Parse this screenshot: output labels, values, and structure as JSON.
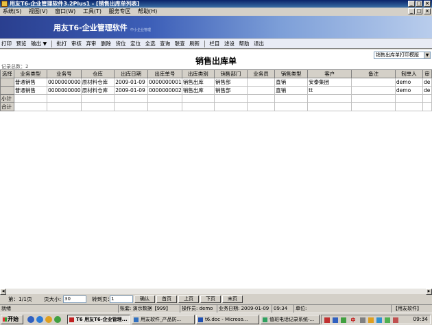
{
  "window": {
    "title": "用友T6-企业管理软件3.2Plus1  - [销售出库单列表]",
    "btn_min": "_",
    "btn_max": "□",
    "btn_close": "×",
    "inner_min": "_",
    "inner_max": "□",
    "inner_close": "×"
  },
  "menu": [
    "系统(S)",
    "视图(V)",
    "窗口(W)",
    "工具(T)",
    "服务专区",
    "帮助(H)"
  ],
  "banner": {
    "logo": "用友T6-企业管理软件",
    "sub": "中小企业管理"
  },
  "toolbar": [
    "打印",
    "预览",
    "输出 ▼",
    "|",
    "批打",
    "审核",
    "弃审",
    "删除",
    "货位",
    "定位",
    "全选",
    "查询",
    "联查",
    "刷新",
    "|",
    "栏目",
    "滤设",
    "帮助",
    "退出"
  ],
  "list": {
    "title": "销售出库单",
    "record_count": "记录总数：2",
    "template": "销售出库单打印模版",
    "template_arrow": "▼",
    "columns": [
      "选择",
      "业务类型",
      "业务号",
      "仓库",
      "出库日期",
      "出库单号",
      "出库类别",
      "销售部门",
      "业务员",
      "销售类型",
      "客户",
      "备注",
      "制单人",
      "审"
    ],
    "rows": [
      [
        "",
        "普通销售",
        "0000000000",
        "原材料仓库",
        "2009-01-09",
        "0000000001",
        "销售出库",
        "销售部",
        "",
        "直销",
        "安泰集团",
        "",
        "demo",
        "de"
      ],
      [
        "",
        "普通销售",
        "0000000000",
        "原材料仓库",
        "2009-01-09",
        "0000000002",
        "销售出库",
        "销售部",
        "",
        "直销",
        "tt",
        "",
        "demo",
        "de"
      ]
    ],
    "subtotal_label": "小计",
    "total_label": "合计"
  },
  "scrollbar": {
    "left": "◀",
    "right": "▶"
  },
  "pager": {
    "page_info": "第：1/1页",
    "page_size_label": "页大小:",
    "page_size": "30",
    "goto_label": "转到页：",
    "goto_value": "1",
    "confirm": "确认",
    "first": "首页",
    "prev": "上页",
    "next": "下页",
    "last": "末页"
  },
  "status": {
    "ready": "就绪",
    "account": "账套: 演示数据【999】",
    "operator": "操作员: demo",
    "biz_date": "业务日期: 2009-01-09",
    "time": "09:34",
    "unit": "单位:",
    "brand": "【用友软件】"
  },
  "taskbar": {
    "start": "开始",
    "tasks": [
      "T6 用友T6-企业管理...",
      "用友软件_产品防...",
      "t6.doc - Microso...",
      "值班电话记录系统-..."
    ],
    "tray_ime": "中",
    "clock": "09:34"
  }
}
